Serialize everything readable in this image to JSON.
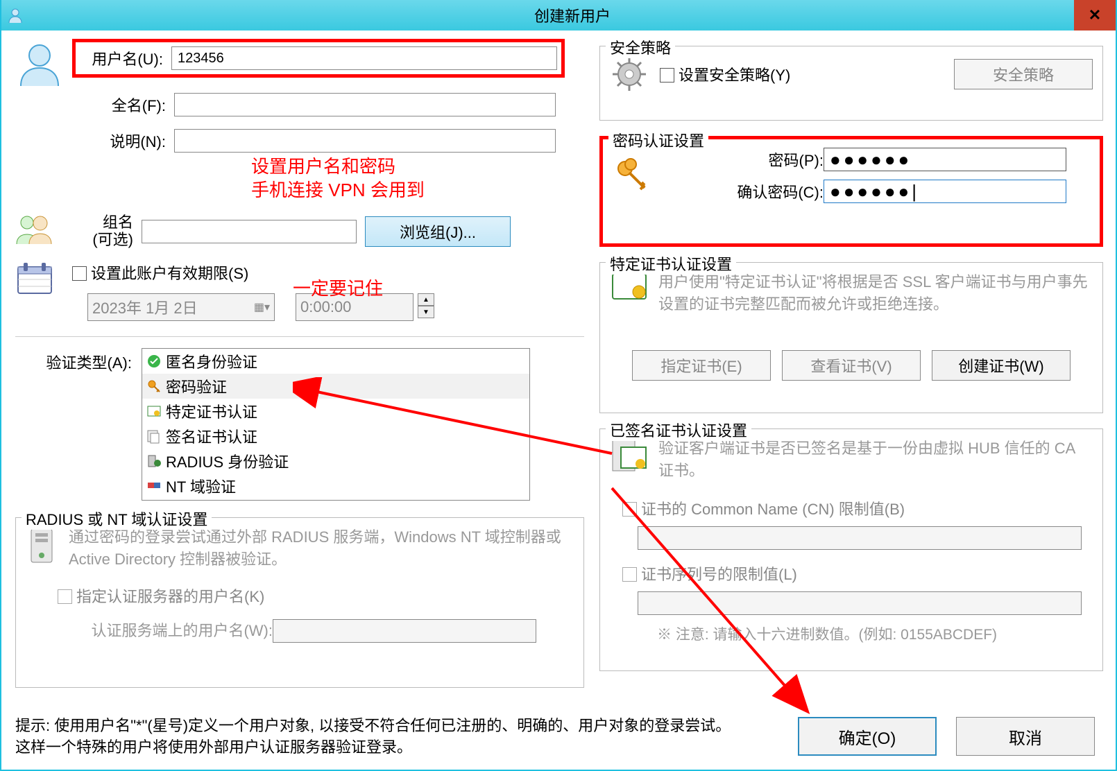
{
  "window": {
    "title": "创建新用户",
    "close": "X"
  },
  "user": {
    "username_label": "用户名(U):",
    "username_value": "123456",
    "fullname_label": "全名(F):",
    "fullname_value": "",
    "desc_label": "说明(N):",
    "desc_value": ""
  },
  "annot": {
    "line1": "设置用户名和密码",
    "line2": "手机连接 VPN 会用到",
    "note": "一定要记住"
  },
  "group": {
    "label1": "组名",
    "label2": "(可选)",
    "browse": "浏览组(J)..."
  },
  "expire": {
    "checkbox": "设置此账户有效期限(S)",
    "date": "2023年 1月 2日",
    "time": "0:00:00"
  },
  "auth": {
    "label": "验证类型(A):",
    "items": [
      "匿名身份验证",
      "密码验证",
      "特定证书认证",
      "签名证书认证",
      "RADIUS 身份验证",
      "NT 域验证"
    ],
    "selected_index": 1
  },
  "radius": {
    "title": "RADIUS 或 NT 域认证设置",
    "desc": "通过密码的登录尝试通过外部 RADIUS 服务端，Windows NT 域控制器或 Active Directory 控制器被验证。",
    "chk_label": "指定认证服务器的用户名(K)",
    "field_label": "认证服务端上的用户名(W):"
  },
  "sec_policy": {
    "title": "安全策略",
    "chk": "设置安全策略(Y)",
    "btn": "安全策略"
  },
  "pwd": {
    "title": "密码认证设置",
    "label1": "密码(P):",
    "label2": "确认密码(C):",
    "masked1": "●●●●●●",
    "masked2": "●●●●●●|"
  },
  "cert": {
    "title": "特定证书认证设置",
    "desc": "用户使用\"特定证书认证\"将根据是否 SSL 客户端证书与用户事先设置的证书完整匹配而被允许或拒绝连接。",
    "btn1": "指定证书(E)",
    "btn2": "查看证书(V)",
    "btn3": "创建证书(W)"
  },
  "signed": {
    "title": "已签名证书认证设置",
    "desc": "验证客户端证书是否已签名是基于一份由虚拟 HUB 信任的 CA 证书。",
    "cn_label": "证书的 Common Name (CN) 限制值(B)",
    "sn_label": "证书序列号的限制值(L)",
    "note": "※ 注意: 请输入十六进制数值。(例如: 0155ABCDEF)"
  },
  "footer": {
    "tip1": "提示: 使用用户名\"*\"(星号)定义一个用户对象, 以接受不符合任何已注册的、明确的、用户对象的登录尝试。这样一个特殊的用户将使用外部用户认证服务器验证登录。",
    "ok": "确定(O)",
    "cancel": "取消"
  }
}
